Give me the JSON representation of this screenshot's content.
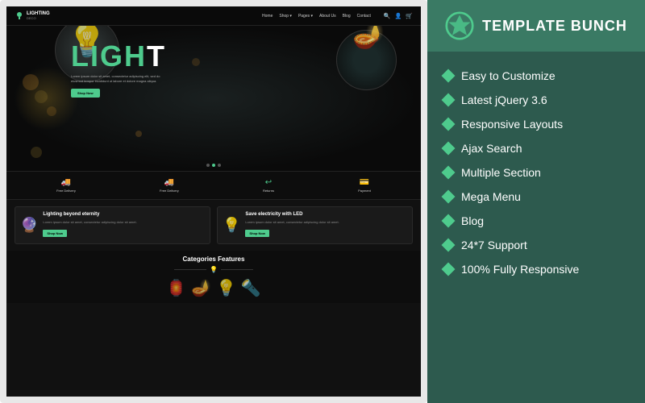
{
  "left": {
    "nav": {
      "logo_text": "LIGHTING",
      "logo_sub": "DECO",
      "links": [
        "Home",
        "Shop ▾",
        "Pages ▾",
        "About Us",
        "Blog",
        "Contact"
      ]
    },
    "hero": {
      "main_text_part1": "LIGH",
      "main_text_part2": "T",
      "subtitle": "Lorem ipsum dolor sit amet, consectetur adipiscing elit, sed do eiusmod tempor incididunt ut labore et dolore magna aliqua.",
      "button": "Shop Now",
      "dots": 3
    },
    "services": [
      {
        "icon": "🚚",
        "label": "Free Delivery"
      },
      {
        "icon": "🚚",
        "label": "Free Delivery"
      },
      {
        "icon": "↩",
        "label": "Returns"
      },
      {
        "icon": "💳",
        "label": "Payment"
      }
    ],
    "products": [
      {
        "title": "Lighting beyond eternity",
        "desc": "Lorem ipsum dolor sit amet, consectetur adipiscing dolor sit amet.",
        "btn": "Shop Now"
      },
      {
        "title": "Save electricity with LED",
        "desc": "Lorem ipsum dolor sit amet, consectetur adipiscing dolor sit amet.",
        "btn": "Shop Now"
      }
    ],
    "categories": {
      "title": "Categories Features"
    }
  },
  "right": {
    "brand": "TEMPLATE BUNCH",
    "features": [
      "Easy to Customize",
      "Latest jQuery 3.6",
      "Responsive Layouts",
      "Ajax Search",
      "Multiple Section",
      "Mega Menu",
      "Blog",
      "24*7 Support",
      "100% Fully Responsive"
    ]
  }
}
